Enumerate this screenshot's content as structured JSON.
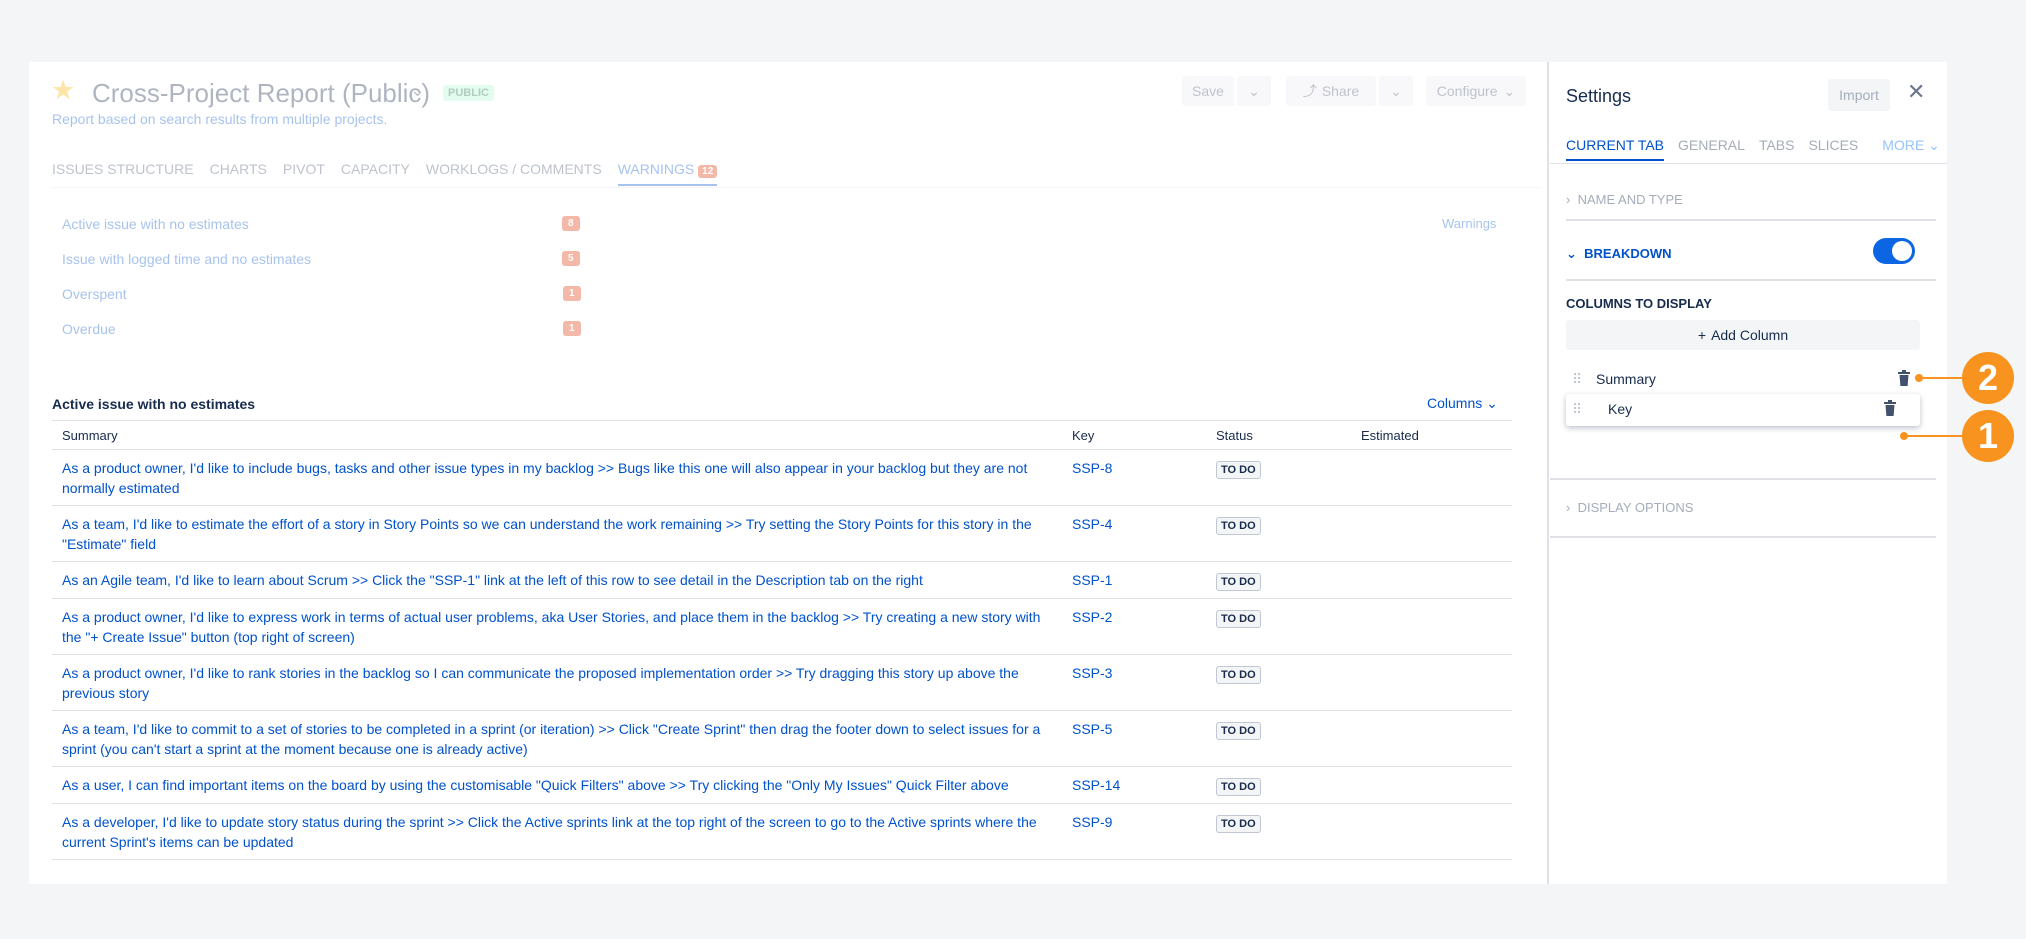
{
  "report": {
    "title": "Cross-Project Report (Public)",
    "badge": "PUBLIC",
    "subtitle": "Report based on search results from multiple projects.",
    "buttons": {
      "save": "Save",
      "share": "Share",
      "configure": "Configure"
    }
  },
  "tabs": [
    {
      "label": "ISSUES STRUCTURE"
    },
    {
      "label": "CHARTS"
    },
    {
      "label": "PIVOT"
    },
    {
      "label": "CAPACITY"
    },
    {
      "label": "WORKLOGS / COMMENTS"
    },
    {
      "label": "WARNINGS",
      "count": "12"
    }
  ],
  "warnings": {
    "link": "Warnings",
    "items": [
      {
        "label": "Active issue with no estimates",
        "count": "8"
      },
      {
        "label": "Issue with logged time and no estimates",
        "count": "5"
      },
      {
        "label": "Overspent",
        "count": "1"
      },
      {
        "label": "Overdue",
        "count": "1"
      }
    ]
  },
  "section": {
    "title": "Active issue with no estimates",
    "columns_button": "Columns",
    "headers": {
      "summary": "Summary",
      "key": "Key",
      "status": "Status",
      "estimated": "Estimated"
    },
    "rows": [
      {
        "summary": "As a product owner, I'd like to include bugs, tasks and other issue types in my backlog >> Bugs like this one will also appear in your backlog but they are not normally estimated",
        "key": "SSP-8",
        "status": "TO DO"
      },
      {
        "summary": "As a team, I'd like to estimate the effort of a story in Story Points so we can understand the work remaining >> Try setting the Story Points for this story in the \"Estimate\" field",
        "key": "SSP-4",
        "status": "TO DO"
      },
      {
        "summary": "As an Agile team, I'd like to learn about Scrum >> Click the \"SSP-1\" link at the left of this row to see detail in the Description tab on the right",
        "key": "SSP-1",
        "status": "TO DO"
      },
      {
        "summary": "As a product owner, I'd like to express work in terms of actual user problems, aka User Stories, and place them in the backlog >> Try creating a new story with the \"+ Create Issue\" button (top right of screen)",
        "key": "SSP-2",
        "status": "TO DO"
      },
      {
        "summary": "As a product owner, I'd like to rank stories in the backlog so I can communicate the proposed implementation order >> Try dragging this story up above the previous story",
        "key": "SSP-3",
        "status": "TO DO"
      },
      {
        "summary": "As a team, I'd like to commit to a set of stories to be completed in a sprint (or iteration) >> Click \"Create Sprint\" then drag the footer down to select issues for a sprint (you can't start a sprint at the moment because one is already active)",
        "key": "SSP-5",
        "status": "TO DO"
      },
      {
        "summary": "As a user, I can find important items on the board by using the customisable \"Quick Filters\" above >> Try clicking the \"Only My Issues\" Quick Filter above",
        "key": "SSP-14",
        "status": "TO DO"
      },
      {
        "summary": "As a developer, I'd like to update story status during the sprint >> Click the Active sprints link at the top right of the screen to go to the Active sprints where the current Sprint's items can be updated",
        "key": "SSP-9",
        "status": "TO DO"
      }
    ]
  },
  "settings": {
    "title": "Settings",
    "import": "Import",
    "tabs": [
      "CURRENT TAB",
      "GENERAL",
      "TABS",
      "SLICES"
    ],
    "more": "MORE",
    "name_and_type": "NAME AND TYPE",
    "breakdown": "BREAKDOWN",
    "columns_to_display": "COLUMNS TO DISPLAY",
    "add_column": "Add Column",
    "columns": [
      "Summary",
      "Key"
    ],
    "display_options": "DISPLAY OPTIONS"
  },
  "callouts": [
    "1",
    "2"
  ],
  "colors": {
    "accent": "#0052cc",
    "callout": "#f7931e",
    "warning": "#de350b",
    "toggle": "#0c66e4"
  }
}
